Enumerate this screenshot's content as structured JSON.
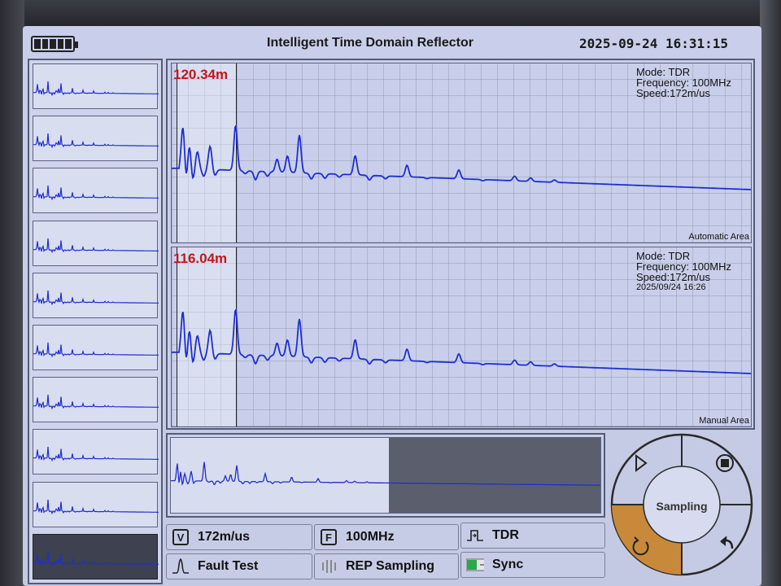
{
  "header": {
    "title": "Intelligent Time Domain Reflector",
    "datetime": "2025-09-24 16:31:15",
    "battery_icon": "battery-full-icon"
  },
  "automatic_area": {
    "distance": "120.34m",
    "mode": "Mode: TDR",
    "frequency": "Frequency: 100MHz",
    "speed": "Speed:172m/us",
    "area_label": "Automatic Area"
  },
  "manual_area": {
    "distance": "116.04m",
    "mode": "Mode: TDR",
    "frequency": "Frequency: 100MHz",
    "speed": "Speed:172m/us",
    "timestamp": "2025/09/24 16:26",
    "area_label": "Manual Area"
  },
  "buttons": {
    "velocity_badge": "V",
    "velocity": "172m/us",
    "frequency_badge": "F",
    "frequency": "100MHz",
    "mode": "TDR",
    "fault_test": "Fault Test",
    "rep_sampling": "REP Sampling",
    "sync": "Sync"
  },
  "dial": {
    "center_label": "Sampling",
    "icons": [
      "play-icon",
      "stop-icon",
      "refresh-icon",
      "back-icon"
    ]
  },
  "colors": {
    "trace": "#1f2fcf",
    "cursor_text": "#c01818",
    "dial_accent": "#c8893a"
  }
}
